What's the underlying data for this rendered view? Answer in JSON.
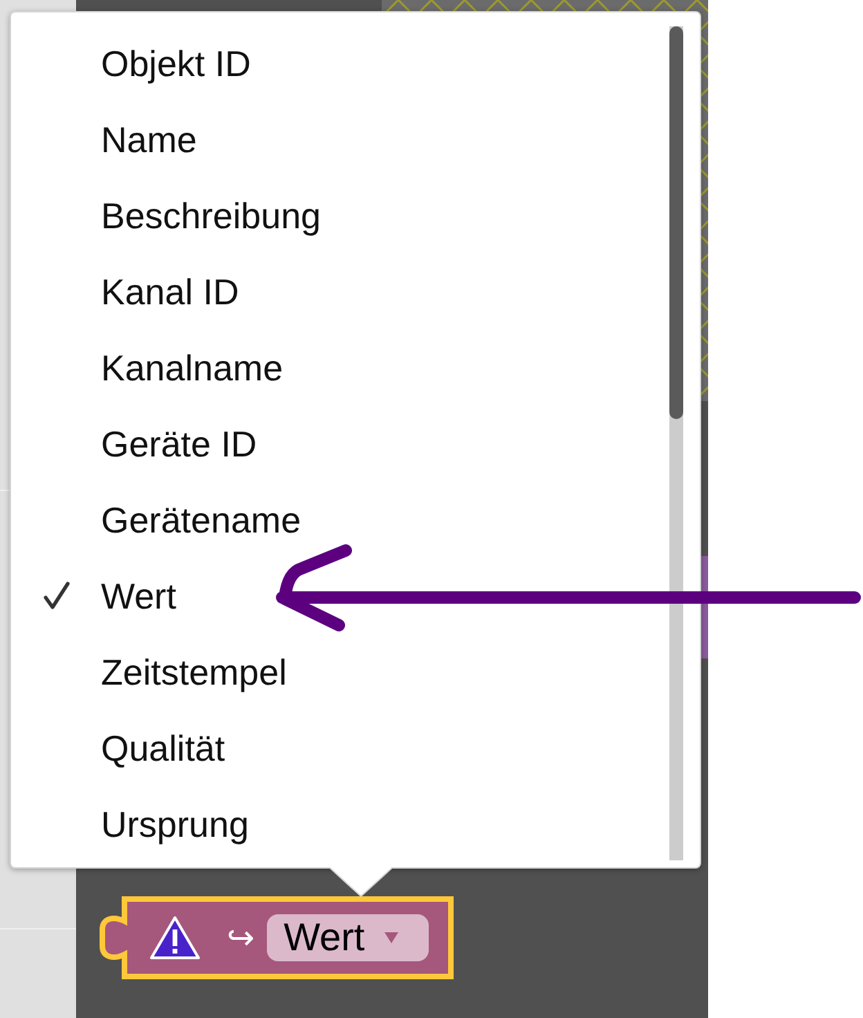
{
  "menu": {
    "items": [
      {
        "label": "Objekt ID",
        "selected": false
      },
      {
        "label": "Name",
        "selected": false
      },
      {
        "label": "Beschreibung",
        "selected": false
      },
      {
        "label": "Kanal ID",
        "selected": false
      },
      {
        "label": "Kanalname",
        "selected": false
      },
      {
        "label": "Geräte ID",
        "selected": false
      },
      {
        "label": "Gerätename",
        "selected": false
      },
      {
        "label": "Wert",
        "selected": true
      },
      {
        "label": "Zeitstempel",
        "selected": false
      },
      {
        "label": "Qualität",
        "selected": false
      },
      {
        "label": "Ursprung",
        "selected": false
      }
    ]
  },
  "block": {
    "selected": true,
    "warning": true,
    "arrow": "↪",
    "dropdown": {
      "value": "Wert"
    }
  }
}
